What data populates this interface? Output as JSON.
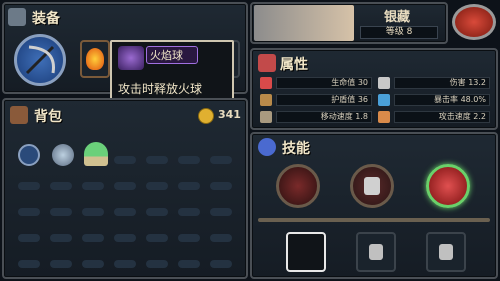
{
  "equip": {
    "title": "装备"
  },
  "tooltip": {
    "name": "火焰球",
    "desc": "攻击时释放火球"
  },
  "hero": {
    "name": "银藏",
    "level_label": "等级 8"
  },
  "attributes": {
    "title": "属性",
    "stats": [
      {
        "label": "生命值",
        "value": "30",
        "color": "#d94a4a"
      },
      {
        "label": "护盾值",
        "value": "36",
        "color": "#b98a4a"
      },
      {
        "label": "移动速度",
        "value": "1.8",
        "color": "#a99a80"
      },
      {
        "label": "伤害",
        "value": "13.2",
        "color": "#c8c8c8"
      },
      {
        "label": "暴击率",
        "value": "48.0%",
        "color": "#4aa0d9"
      },
      {
        "label": "攻击速度",
        "value": "2.2",
        "color": "#d98a4a"
      }
    ]
  },
  "backpack": {
    "title": "背包",
    "coins": "341"
  },
  "skills": {
    "title": "技能"
  },
  "colors": {
    "accent": "#d94a2a",
    "gold": "#e0b030",
    "panel_border": "#4a4f55"
  }
}
